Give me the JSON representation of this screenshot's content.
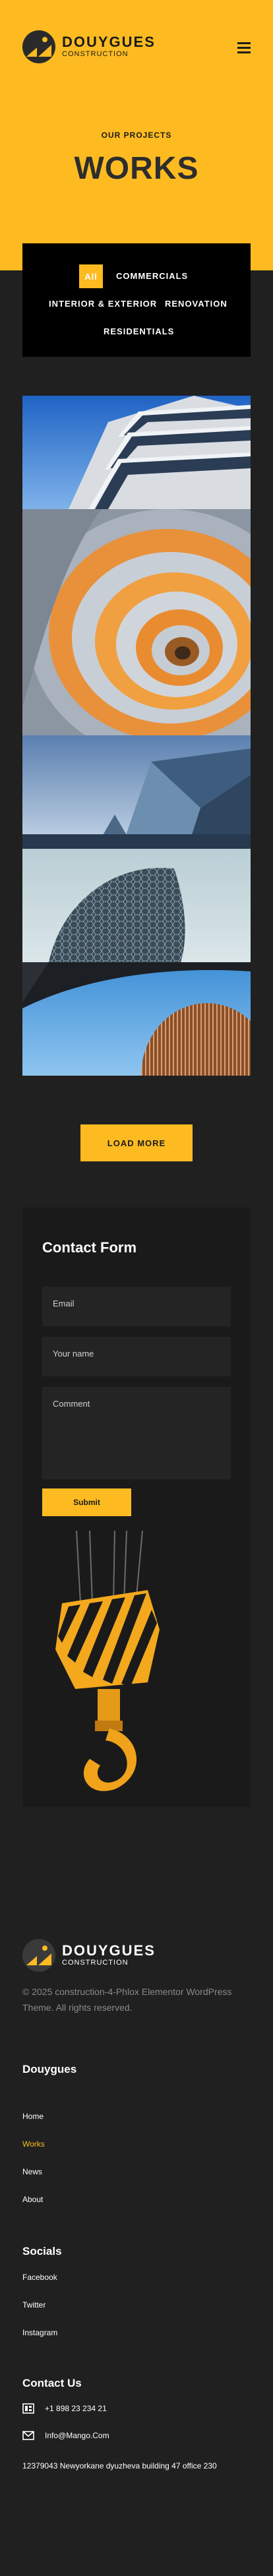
{
  "header": {
    "brand_name": "DOUYGUES",
    "brand_sub": "CONSTRUCTION",
    "menu_icon": "hamburger-icon"
  },
  "hero": {
    "eyebrow": "OUR PROJECTS",
    "title": "WORKS",
    "background": "#fdbb21"
  },
  "filter": {
    "items": [
      "All",
      "COMMERCIALS",
      "INTERIOR & EXTERIOR",
      "RENOVATION",
      "RESIDENTIALS"
    ],
    "active": "All"
  },
  "gallery": {
    "images": [
      "glass-balcony-building",
      "spiral-staircase",
      "angular-glass-tower",
      "curved-hexagon-tower",
      "round-tower-from-below"
    ]
  },
  "load_more": {
    "label": "LOAD MORE"
  },
  "contact": {
    "title": "Contact Form",
    "email_placeholder": "Email",
    "name_placeholder": "Your name",
    "comment_placeholder": "Comment",
    "submit_label": "Submit"
  },
  "footer": {
    "brand_name": "DOUYGUES",
    "brand_sub": "CONSTRUCTION",
    "copyright": "© 2025 construction-4-Phlox Elementor WordPress Theme. All rights reserved.",
    "menu_heading": "Douygues",
    "menu": [
      "Home",
      "Works",
      "News",
      "About"
    ],
    "active_menu": "Works",
    "socials_heading": "Socials",
    "socials": [
      "Facebook",
      "Twitter",
      "Instagram"
    ],
    "contact_heading": "Contact Us",
    "phone": "+1 898 23 234 21",
    "email": "Info@Mango.Com",
    "address": "12379043 Newyorkane dyuzheva building 47 office 230"
  },
  "colors": {
    "accent": "#fdbb21",
    "dark": "#202020",
    "panel": "#1a1a1a"
  }
}
